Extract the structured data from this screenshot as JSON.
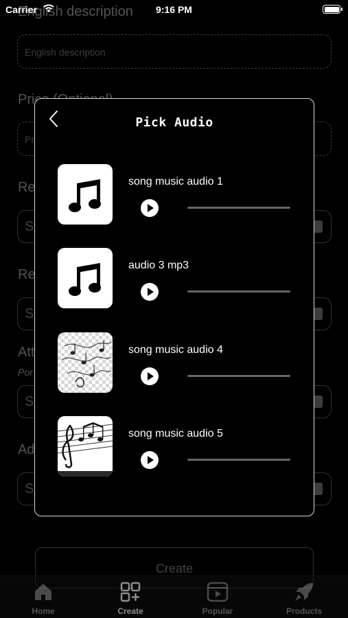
{
  "status_bar": {
    "carrier": "Carrier",
    "time": "9:16 PM"
  },
  "form": {
    "english_description_label": "English description",
    "english_description_placeholder": "English description",
    "price_label": "Price (Optional)",
    "price_placeholder": "Pr",
    "field_3_label": "Re",
    "field_3_value": "S",
    "field_4_label": "Re",
    "field_4_value": "S",
    "field_5_label": "Att",
    "field_5_hint": "Por",
    "field_5_value": "S",
    "field_6_label": "Ad",
    "field_6_value": "S",
    "create_button": "Create"
  },
  "modal": {
    "title": "Pick Audio",
    "items": [
      {
        "name": "song music audio 1",
        "thumb_icon": "music-note-icon",
        "progress": 0
      },
      {
        "name": "audio 3 mp3",
        "thumb_icon": "music-note-icon",
        "progress": 0
      },
      {
        "name": "song music audio 4",
        "thumb_icon": "sheet-music-image",
        "progress": 0
      },
      {
        "name": "song music audio 5",
        "thumb_icon": "treble-clef-image",
        "progress": 0
      }
    ]
  },
  "tab_bar": {
    "active": "Create",
    "tabs": [
      {
        "label": "Home",
        "icon": "home-icon"
      },
      {
        "label": "Create",
        "icon": "grid-plus-icon"
      },
      {
        "label": "Popular",
        "icon": "video-play-icon"
      },
      {
        "label": "Products",
        "icon": "rocket-icon"
      }
    ]
  }
}
